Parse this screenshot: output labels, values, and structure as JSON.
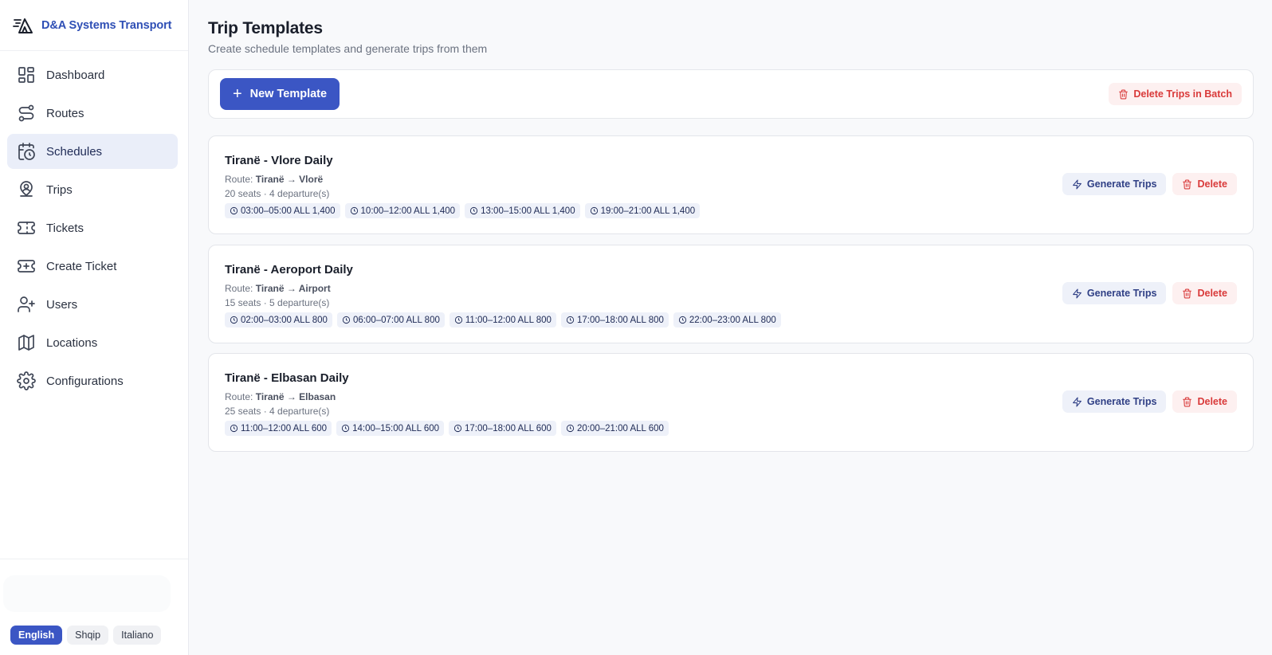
{
  "brand": {
    "name": "D&A Systems Transport"
  },
  "nav": {
    "items": [
      {
        "label": "Dashboard",
        "icon": "dashboard-icon",
        "active": false
      },
      {
        "label": "Routes",
        "icon": "route-icon",
        "active": false
      },
      {
        "label": "Schedules",
        "icon": "calendar-clock-icon",
        "active": true
      },
      {
        "label": "Trips",
        "icon": "map-pin-user-icon",
        "active": false
      },
      {
        "label": "Tickets",
        "icon": "ticket-icon",
        "active": false
      },
      {
        "label": "Create Ticket",
        "icon": "ticket-plus-icon",
        "active": false
      },
      {
        "label": "Users",
        "icon": "user-plus-icon",
        "active": false
      },
      {
        "label": "Locations",
        "icon": "map-icon",
        "active": false
      },
      {
        "label": "Configurations",
        "icon": "gear-icon",
        "active": false
      }
    ]
  },
  "languages": [
    {
      "label": "English",
      "active": true
    },
    {
      "label": "Shqip",
      "active": false
    },
    {
      "label": "Italiano",
      "active": false
    }
  ],
  "page": {
    "title": "Trip Templates",
    "subtitle": "Create schedule templates and generate trips from them"
  },
  "toolbar": {
    "new_template": "New Template",
    "delete_batch": "Delete Trips in Batch"
  },
  "templates": [
    {
      "title": "Tiranë - Vlore Daily",
      "route_label": "Route: ",
      "route": "Tiranë → Vlorë",
      "meta": "20 seats · 4 departure(s)",
      "departures": [
        "03:00–05:00 ALL 1,400",
        "10:00–12:00 ALL 1,400",
        "13:00–15:00 ALL 1,400",
        "19:00–21:00 ALL 1,400"
      ],
      "generate": "Generate Trips",
      "delete": "Delete"
    },
    {
      "title": "Tiranë - Aeroport Daily",
      "route_label": "Route: ",
      "route": "Tiranë → Airport",
      "meta": "15 seats · 5 departure(s)",
      "departures": [
        "02:00–03:00 ALL 800",
        "06:00–07:00 ALL 800",
        "11:00–12:00 ALL 800",
        "17:00–18:00 ALL 800",
        "22:00–23:00 ALL 800"
      ],
      "generate": "Generate Trips",
      "delete": "Delete"
    },
    {
      "title": "Tiranë - Elbasan Daily",
      "route_label": "Route: ",
      "route": "Tiranë → Elbasan",
      "meta": "25 seats · 4 departure(s)",
      "departures": [
        "11:00–12:00 ALL 600",
        "14:00–15:00 ALL 600",
        "17:00–18:00 ALL 600",
        "20:00–21:00 ALL 600"
      ],
      "generate": "Generate Trips",
      "delete": "Delete"
    }
  ],
  "colors": {
    "accent": "#3b56c4",
    "danger": "#d93a3a",
    "active_nav_bg": "#eaeef9"
  }
}
